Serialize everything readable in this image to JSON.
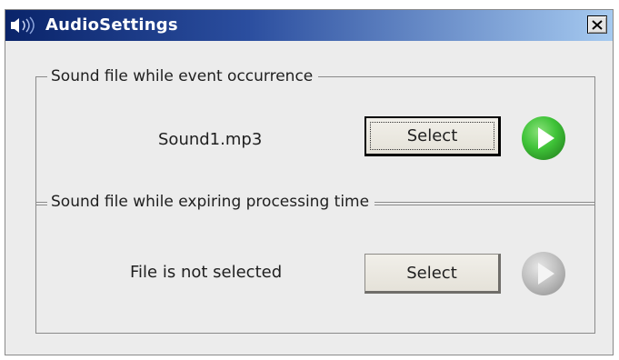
{
  "window": {
    "title": "AudioSettings",
    "close_label": "X"
  },
  "colors": {
    "titlebar_start": "#0a246a",
    "titlebar_end": "#a6caf0",
    "play_active": "#3fc338",
    "play_disabled": "#c2c2c2"
  },
  "groups": [
    {
      "caption": "Sound file while event occurrence",
      "file_label": "Sound1.mp3",
      "select_label": "Select",
      "play_icon": "play-icon-green"
    },
    {
      "caption": "Sound file while expiring processing time",
      "file_label": "File is not selected",
      "select_label": "Select",
      "play_icon": "play-icon-disabled"
    }
  ]
}
